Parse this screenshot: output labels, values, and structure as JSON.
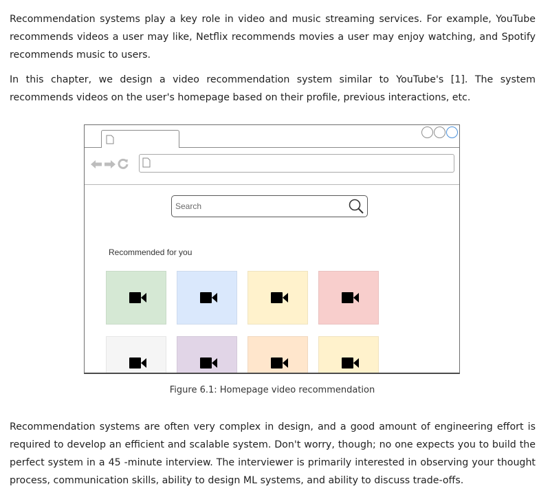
{
  "paragraphs": {
    "intro": "Recommendation systems play a key role in video and music streaming services. For example, YouTube recommends videos a user may like, Netflix recommends movies a user may enjoy watching, and Spotify recommends music to users.",
    "chapter": "In this chapter, we design a video recommendation system similar to YouTube's [1]. The system recommends videos on the user's homepage based on their profile, previous interactions, etc.",
    "complexity": "Recommendation systems are often very complex in design, and a good amount of engineering effort is required to develop an efficient and scalable system. Don't worry, though; no one expects you to build the perfect system in a 45 -minute interview. The interviewer is primarily interested in observing your thought process, communication skills, ability to design ML systems, and ability to discuss trade-offs."
  },
  "figure": {
    "caption": "Figure 6.1: Homepage video recommendation",
    "browser": {
      "icons": [
        "page-icon",
        "back-arrow-icon",
        "forward-arrow-icon",
        "refresh-icon",
        "window-control-icon"
      ],
      "search_placeholder": "Search",
      "recommended_heading": "Recommended for you",
      "video_tiles": [
        {
          "name": "video-tile-1",
          "color": "#d5e8d4",
          "icon": "video-camera-icon"
        },
        {
          "name": "video-tile-2",
          "color": "#dae8fc",
          "icon": "video-camera-icon"
        },
        {
          "name": "video-tile-3",
          "color": "#fff2cc",
          "icon": "video-camera-icon"
        },
        {
          "name": "video-tile-4",
          "color": "#f8cecc",
          "icon": "video-camera-icon"
        },
        {
          "name": "video-tile-5",
          "color": "#f5f5f5",
          "icon": "video-camera-icon"
        },
        {
          "name": "video-tile-6",
          "color": "#e1d5e7",
          "icon": "video-camera-icon"
        },
        {
          "name": "video-tile-7",
          "color": "#ffe6cc",
          "icon": "video-camera-icon"
        },
        {
          "name": "video-tile-8",
          "color": "#fff2cc",
          "icon": "video-camera-icon"
        }
      ]
    }
  }
}
